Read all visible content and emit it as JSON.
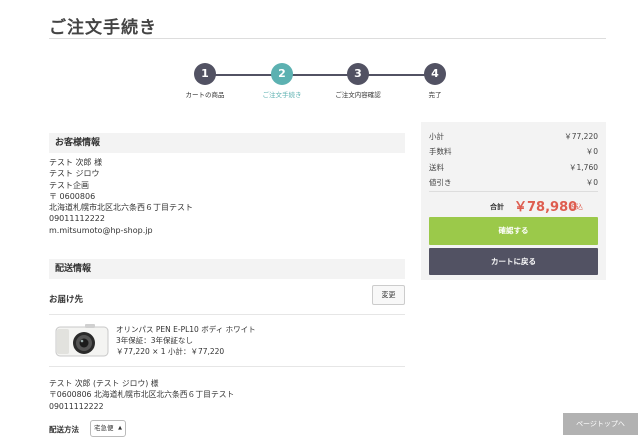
{
  "page": {
    "title": "ご注文手続き"
  },
  "steps": [
    {
      "num": "1",
      "label": "カートの商品"
    },
    {
      "num": "2",
      "label": "ご注文手続き"
    },
    {
      "num": "3",
      "label": "ご注文内容確認"
    },
    {
      "num": "4",
      "label": "完了"
    }
  ],
  "customer": {
    "heading": "お客様情報",
    "lines": [
      "テスト 次郎 様",
      "テスト ジロウ",
      "テスト企画",
      "〒 0600806",
      "北海道札幌市北区北六条西６丁目テスト",
      "09011112222",
      "m.mitsumoto@hp-shop.jp"
    ]
  },
  "shipping": {
    "heading": "配送情報",
    "destination_label": "お届け先",
    "change_label": "変更",
    "product": {
      "name": "オリンパス PEN E-PL10 ボディ ホワイト",
      "warranty": "3年保証：3年保証なし",
      "price_line": "￥77,220 × 1 小計：￥77,220"
    },
    "recipient": [
      "テスト 次郎 (テスト ジロウ) 様",
      "〒0600806 北海道札幌市北区北六条西６丁目テスト",
      "09011112222"
    ],
    "method_label": "配送方法",
    "method_value": "宅急便"
  },
  "summary": {
    "rows": [
      {
        "label": "小計",
        "value": "￥77,220"
      },
      {
        "label": "手数料",
        "value": "￥0"
      },
      {
        "label": "送料",
        "value": "￥1,760"
      },
      {
        "label": "値引き",
        "value": "￥0"
      }
    ],
    "total_label": "合計",
    "total_value": "￥78,980",
    "tax_note": "税込",
    "confirm_label": "確認する",
    "back_label": "カートに戻る"
  },
  "pagetop_label": "ページトップへ",
  "colors": {
    "accent": "#5cb1b1",
    "step": "#525263",
    "confirm": "#9bc94a",
    "total": "#de5d50"
  }
}
